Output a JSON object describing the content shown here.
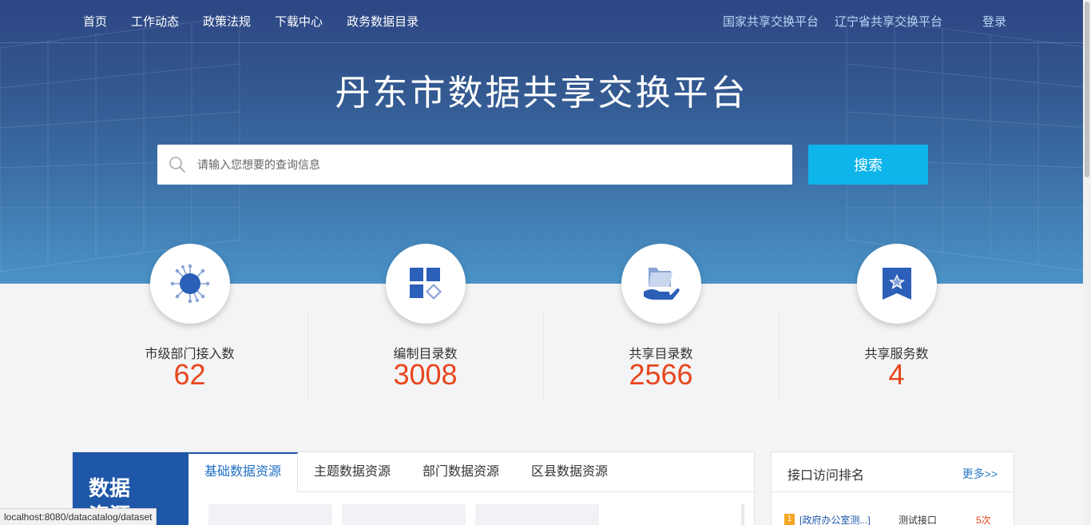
{
  "nav": {
    "left": [
      "首页",
      "工作动态",
      "政策法规",
      "下载中心",
      "政务数据目录"
    ],
    "right": [
      "国家共享交换平台",
      "辽宁省共享交换平台"
    ],
    "login": "登录"
  },
  "hero": {
    "title": "丹东市数据共享交换平台"
  },
  "search": {
    "placeholder": "请输入您想要的查询信息",
    "button": "搜索"
  },
  "stats": [
    {
      "icon": "network-node-icon",
      "label": "市级部门接入数",
      "value": "62"
    },
    {
      "icon": "catalog-blocks-icon",
      "label": "编制目录数",
      "value": "3008"
    },
    {
      "icon": "shared-folder-hand-icon",
      "label": "共享目录数",
      "value": "2566"
    },
    {
      "icon": "star-badge-icon",
      "label": "共享服务数",
      "value": "4"
    }
  ],
  "data_panel": {
    "side_title": "数据资源",
    "tabs": [
      "基础数据资源",
      "主题数据资源",
      "部门数据资源",
      "区县数据资源"
    ],
    "active_tab": 0
  },
  "ranking": {
    "title": "接口访问排名",
    "more": "更多>>",
    "rows": [
      {
        "rank": "1",
        "name": "[政府办公室测...]",
        "type": "测试接口",
        "count": "5次"
      }
    ]
  },
  "status_bar": {
    "url": "localhost:8080/datacatalog/dataset"
  },
  "colors": {
    "accent": "#0eb5ea",
    "brand": "#1e56a8",
    "number": "#e8461e"
  }
}
